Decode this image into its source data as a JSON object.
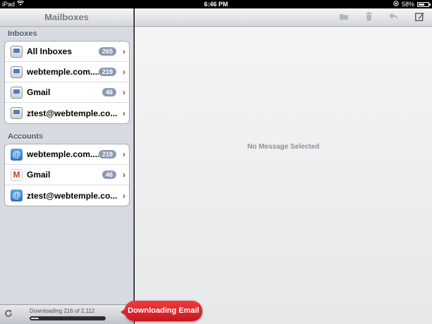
{
  "statusbar": {
    "device": "iPad",
    "time": "6:46 PM",
    "battery_percent": "58%",
    "battery_level": 0.58
  },
  "sidebar": {
    "title": "Mailboxes",
    "sections": {
      "inboxes": {
        "header": "Inboxes",
        "items": [
          {
            "label": "All Inboxes",
            "count": "265",
            "icon": "inbox-icon"
          },
          {
            "label": "webtemple.com....",
            "count": "219",
            "icon": "inbox-icon"
          },
          {
            "label": "Gmail",
            "count": "46",
            "icon": "inbox-icon"
          },
          {
            "label": "ztest@webtemple.co...",
            "count": "",
            "icon": "inbox-icon"
          }
        ]
      },
      "accounts": {
        "header": "Accounts",
        "items": [
          {
            "label": "webtemple.com....",
            "count": "219",
            "icon": "at-icon"
          },
          {
            "label": "Gmail",
            "count": "46",
            "icon": "gmail-icon"
          },
          {
            "label": "ztest@webtemple.co...",
            "count": "",
            "icon": "at-icon"
          }
        ]
      }
    },
    "toolbar": {
      "status": "Downloading 216 of 2,112",
      "progress": 0.102
    }
  },
  "main": {
    "empty_message": "No Message Selected"
  },
  "callout": {
    "label": "Downloading Email"
  },
  "colors": {
    "badge": "#8c99b3",
    "callout": "#d8262b",
    "sidebar_bg": "#d7dbe1"
  }
}
